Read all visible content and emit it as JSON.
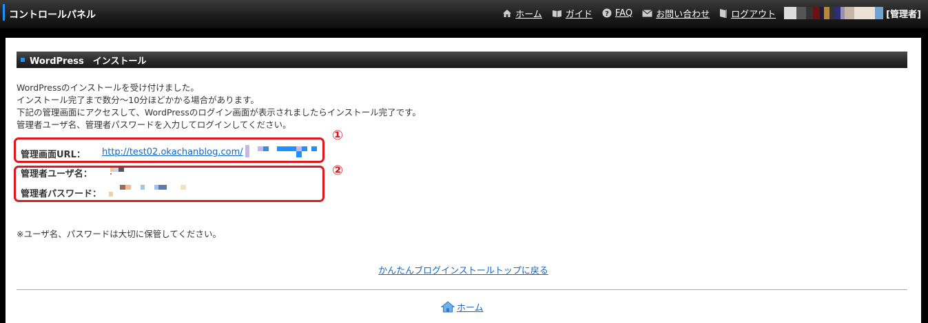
{
  "header": {
    "title": "コントロールパネル",
    "nav": [
      {
        "label": "ホーム",
        "icon": "home-icon"
      },
      {
        "label": "ガイド",
        "icon": "book-icon"
      },
      {
        "label": "FAQ",
        "icon": "question-icon"
      },
      {
        "label": "お問い合わせ",
        "icon": "mail-icon"
      },
      {
        "label": "ログアウト",
        "icon": "door-icon"
      }
    ],
    "role": "[管理者]"
  },
  "section": {
    "title": "WordPress　インストール"
  },
  "message": [
    "WordPressのインストールを受け付けました。",
    "インストール完了まで数分〜10分ほどかかる場合があります。",
    "下記の管理画面にアクセスして、WordPressのログイン画面が表示されましたらインストール完了です。",
    "管理者ユーザ名、管理者パスワードを入力してログインしてください。"
  ],
  "fields": {
    "url_label": "管理画面URL：",
    "url_value": "http://test02.okachanblog.com/",
    "user_label": "管理者ユーザ名：",
    "pass_label": "管理者パスワード："
  },
  "annotations": {
    "one": "①",
    "two": "②"
  },
  "note": "※ユーザ名、パスワードは大切に保管してください。",
  "back_link": "かんたんブログインストールトップに戻る",
  "footer_home": "ホーム",
  "colors": {
    "accent": "#1e90ff",
    "annotation": "#e0161a",
    "link": "#1565c0"
  }
}
